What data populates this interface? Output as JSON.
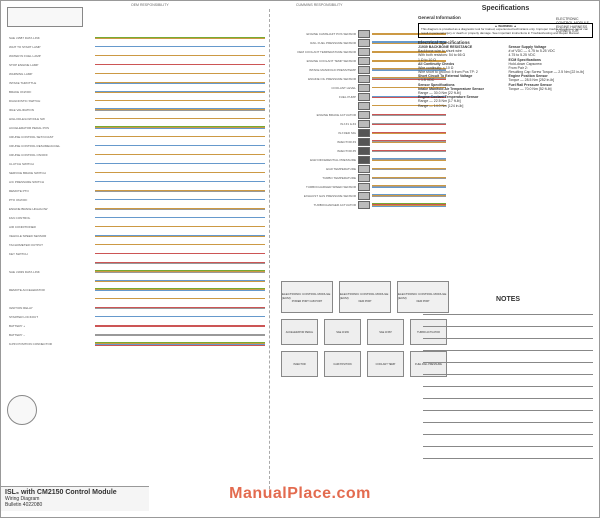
{
  "header": {
    "oem_resp": "OEM RESPONSIBILITY",
    "cummins_resp": "CUMMINS RESPONSIBILITY"
  },
  "ecm_label": "ELECTRONIC CONTROL MODULE",
  "ecm_conn_label": "ENGINE HARNESS CONNECTOR",
  "title_block": {
    "main": "ISL₉ with CM2150 Control Module",
    "sub": "Wiring Diagram",
    "part": "Bulletin  4022080"
  },
  "watermark": "ManualPlace.com",
  "specifications": {
    "title": "Specifications",
    "general_info": "General Information",
    "warning_label": "▲ WARNING ▲",
    "warning_text": "This diagram is provided as a diagnostic tool for trained, experienced technicians only. Improper trouble-shooting or repair can result in personal injury or death or property damage. See important instructions in Troubleshooting and Repair Manual.",
    "electrical_title": "Electrical Specifications",
    "j1939": {
      "title": "J1939 BACKBONE RESISTANCE",
      "items": [
        "Backbone wire to shunt wire",
        "With both resistors: 54 to 66 Ω",
        "1 Ω to 10 Ω"
      ]
    },
    "continuity": {
      "title": "All Continuity Checks",
      "items": [
        "Wire continuity: < 10 Ω",
        "Wire short to ground: 5 from Pos TP: 2"
      ]
    },
    "short": {
      "title": "Short Circuit To External Voltage",
      "items": [
        "< 1.5 VDC"
      ]
    },
    "sensor_spec": {
      "title": "Sensor Specifications"
    },
    "intake_temp": {
      "title": "Intake Manifold Air Temperature Sensor",
      "items": [
        "Range — 30.0 Nm [22 ft-lb]"
      ]
    },
    "coolant_temp": {
      "title": "Engine Coolant Temperature Sensor",
      "items": [
        "Range — 22.5 Nm [17 ft-lb]",
        "Range — 14.0 Nm [124 in-lb]"
      ]
    },
    "supply_v": {
      "title": "Sensor Supply Voltage",
      "items": [
        "# of VDC — 4.75 to 5.25 VDC",
        "4.75 to 5.25 VDC"
      ]
    },
    "ecm_spec": {
      "title": "ECM Specifications",
      "items": [
        "Hold-down Capscrew",
        "From Pair 2:",
        "Resulting Cap Screw Torque — 2.5 Nm [22 in-lb]"
      ]
    },
    "eng_pos": {
      "title": "Engine Position Sensor",
      "items": [
        "Torque — 28.5 Nm [252 in-lb]"
      ]
    },
    "fuel_rail": {
      "title": "Fuel Rail Pressure Sensor",
      "items": [
        "Torque — 70.0 Nm [52 ft-lb]"
      ]
    }
  },
  "notes_title": "NOTES",
  "right_wires": [
    {
      "label": "ENGINE CAMSHAFT POS SENSOR",
      "colors": [
        "#c94",
        "#c94"
      ]
    },
    {
      "label": "RAIL FUEL PRESSURE SENSOR",
      "colors": [
        "#69c",
        "#69c",
        "#c94"
      ]
    },
    {
      "label": "OEM COOLANT TEMPERATURE SENSOR",
      "colors": [
        "#c94",
        "#c94"
      ]
    },
    {
      "label": "ENGINE COOLANT TEMP SENSOR",
      "colors": [
        "#c94",
        "#c94"
      ]
    },
    {
      "label": "INTAKE MANIFOLD PRESS/TEMP",
      "colors": [
        "#c94",
        "#999",
        "#69c"
      ]
    },
    {
      "label": "ENGINE OIL PRESSURE SENSOR",
      "colors": [
        "#c94",
        "#999",
        "#c55"
      ]
    },
    {
      "label": "COOLANT LEVEL",
      "colors": [
        "#c94"
      ]
    },
    {
      "label": "FUEL PUMP",
      "colors": [
        "#69c",
        "#c55"
      ]
    },
    {
      "label": "",
      "colors": [
        "#c94"
      ]
    },
    {
      "label": "ENGINE BRAKE ACTUATOR",
      "colors": [
        "#c55",
        "#999"
      ]
    },
    {
      "label": "INJ #1 & #4",
      "colors": [
        "#999",
        "#c55"
      ]
    },
    {
      "label": "INJ RED SIG",
      "colors": [
        "#c55",
        "#c94"
      ]
    },
    {
      "label": "INJECTOR #3",
      "colors": [
        "#c55",
        "#999",
        "#c94"
      ]
    },
    {
      "label": "INJECTOR #5",
      "colors": [
        "#c55",
        "#999"
      ]
    },
    {
      "label": "EGR DIFFERENTIAL PRESSURE",
      "colors": [
        "#69c",
        "#999",
        "#c94"
      ]
    },
    {
      "label": "EGR TEMPERATURE",
      "colors": [
        "#c94",
        "#999"
      ]
    },
    {
      "label": "TURBO TEMPERATURE",
      "colors": [
        "#c94",
        "#999"
      ]
    },
    {
      "label": "TURBOCHARGER SPEED SENSOR",
      "colors": [
        "#c94",
        "#999",
        "#69c"
      ]
    },
    {
      "label": "EXHAUST GAS PRESSURE SENSOR",
      "colors": [
        "#69c",
        "#c94",
        "#999"
      ]
    },
    {
      "label": "TURBOCHARGER ACTUATOR",
      "colors": [
        "#7a3",
        "#c55",
        "#c94",
        "#69c"
      ]
    }
  ],
  "left_wires": [
    {
      "label": "SAE J1587 DATA LINK",
      "colors": [
        "#7a3",
        "#c94"
      ]
    },
    {
      "label": "WAIT TO START LAMP",
      "colors": [
        "#69c"
      ]
    },
    {
      "label": "WATER IN FUEL LAMP",
      "colors": [
        "#c94"
      ]
    },
    {
      "label": "STOP ENGINE LAMP",
      "colors": [
        "#c55"
      ]
    },
    {
      "label": "WARNING LAMP",
      "colors": [
        "#c94"
      ]
    },
    {
      "label": "INTAKE THROTTLE",
      "colors": [
        "#c94",
        "#69c"
      ]
    },
    {
      "label": "BRAKE ON/OFF",
      "colors": [
        "#69c",
        "#c94"
      ]
    },
    {
      "label": "DIAGNOSTIC SWITCH",
      "colors": [
        "#c94"
      ]
    },
    {
      "label": "IDLE VALIDATION",
      "colors": [
        "#69c",
        "#c94",
        "#999"
      ]
    },
    {
      "label": "HIGH IDLE/LOW IDLE SW",
      "colors": [
        "#c94"
      ]
    },
    {
      "label": "ACCELERATOR PEDAL POS",
      "colors": [
        "#7a3",
        "#c94",
        "#69c"
      ]
    },
    {
      "label": "CRUISE CONTROL SET/COAST",
      "colors": [
        "#c94"
      ]
    },
    {
      "label": "CRUISE CONTROL RESUME/ACCEL",
      "colors": [
        "#69c"
      ]
    },
    {
      "label": "CRUISE CONTROL ON/OFF",
      "colors": [
        "#c94"
      ]
    },
    {
      "label": "CLUTCH SWITCH",
      "colors": [
        "#69c"
      ]
    },
    {
      "label": "SERVICE BRAKE SWITCH",
      "colors": [
        "#c94"
      ]
    },
    {
      "label": "A/C PRESSURE SWITCH",
      "colors": [
        "#69c"
      ]
    },
    {
      "label": "REMOTE PTO",
      "colors": [
        "#c94",
        "#999"
      ]
    },
    {
      "label": "PTO ON/OFF",
      "colors": [
        "#69c"
      ]
    },
    {
      "label": "ENGINE BRAKE HIGH/LOW",
      "colors": [
        "#c94",
        "#999"
      ]
    },
    {
      "label": "FAN CONTROL",
      "colors": [
        "#69c"
      ]
    },
    {
      "label": "AIR CONDITIONER",
      "colors": [
        "#c94"
      ]
    },
    {
      "label": "VEHICLE SPEED SENSOR",
      "colors": [
        "#69c",
        "#c94"
      ]
    },
    {
      "label": "TACHOMETER OUTPUT",
      "colors": [
        "#c94"
      ]
    },
    {
      "label": "KEY SWITCH",
      "colors": [
        "#c55"
      ]
    },
    {
      "label": "",
      "colors": [
        "#c55",
        "#999"
      ]
    },
    {
      "label": "SAE J1939 DATA LINK",
      "colors": [
        "#7a3",
        "#c94",
        "#999"
      ]
    },
    {
      "label": "",
      "colors": [
        "#69c",
        "#c94"
      ]
    },
    {
      "label": "REMOTE ACCELERATOR",
      "colors": [
        "#7a3",
        "#c94",
        "#69c"
      ]
    },
    {
      "label": "",
      "colors": [
        "#c94"
      ]
    },
    {
      "label": "IGNITION RELAY",
      "colors": [
        "#c55",
        "#999"
      ]
    },
    {
      "label": "STARTER LOCKOUT",
      "colors": [
        "#69c"
      ]
    },
    {
      "label": "BATTERY +",
      "colors": [
        "#c55",
        "#c55"
      ]
    },
    {
      "label": "BATTERY –",
      "colors": [
        "#999",
        "#999"
      ]
    },
    {
      "label": "9-PIN POSITION CONNECTOR",
      "colors": [
        "#7a3",
        "#c94",
        "#69c",
        "#c55"
      ]
    }
  ],
  "connectors": [
    {
      "label": "ELECTRONIC CONTROL MODULE (ECM)",
      "sub": "POWER PORT   CAB PORT"
    },
    {
      "label": "ELECTRONIC CONTROL MODULE (ECM)",
      "sub": "OEM PORT"
    },
    {
      "label": "ELECTRONIC CONTROL MODULE (ECM)",
      "sub": "OEM PORT"
    },
    {
      "label": "ACCELERATOR PEDAL",
      "sub": ""
    },
    {
      "label": "SAE J1939",
      "sub": ""
    },
    {
      "label": "SAE J1587",
      "sub": ""
    },
    {
      "label": "TURBO ACTUATOR",
      "sub": ""
    },
    {
      "label": "INJECTOR",
      "sub": ""
    },
    {
      "label": "CAM POSITION",
      "sub": ""
    },
    {
      "label": "COOLANT TEMP",
      "sub": ""
    },
    {
      "label": "FUEL RAIL PRESSURE",
      "sub": ""
    }
  ]
}
